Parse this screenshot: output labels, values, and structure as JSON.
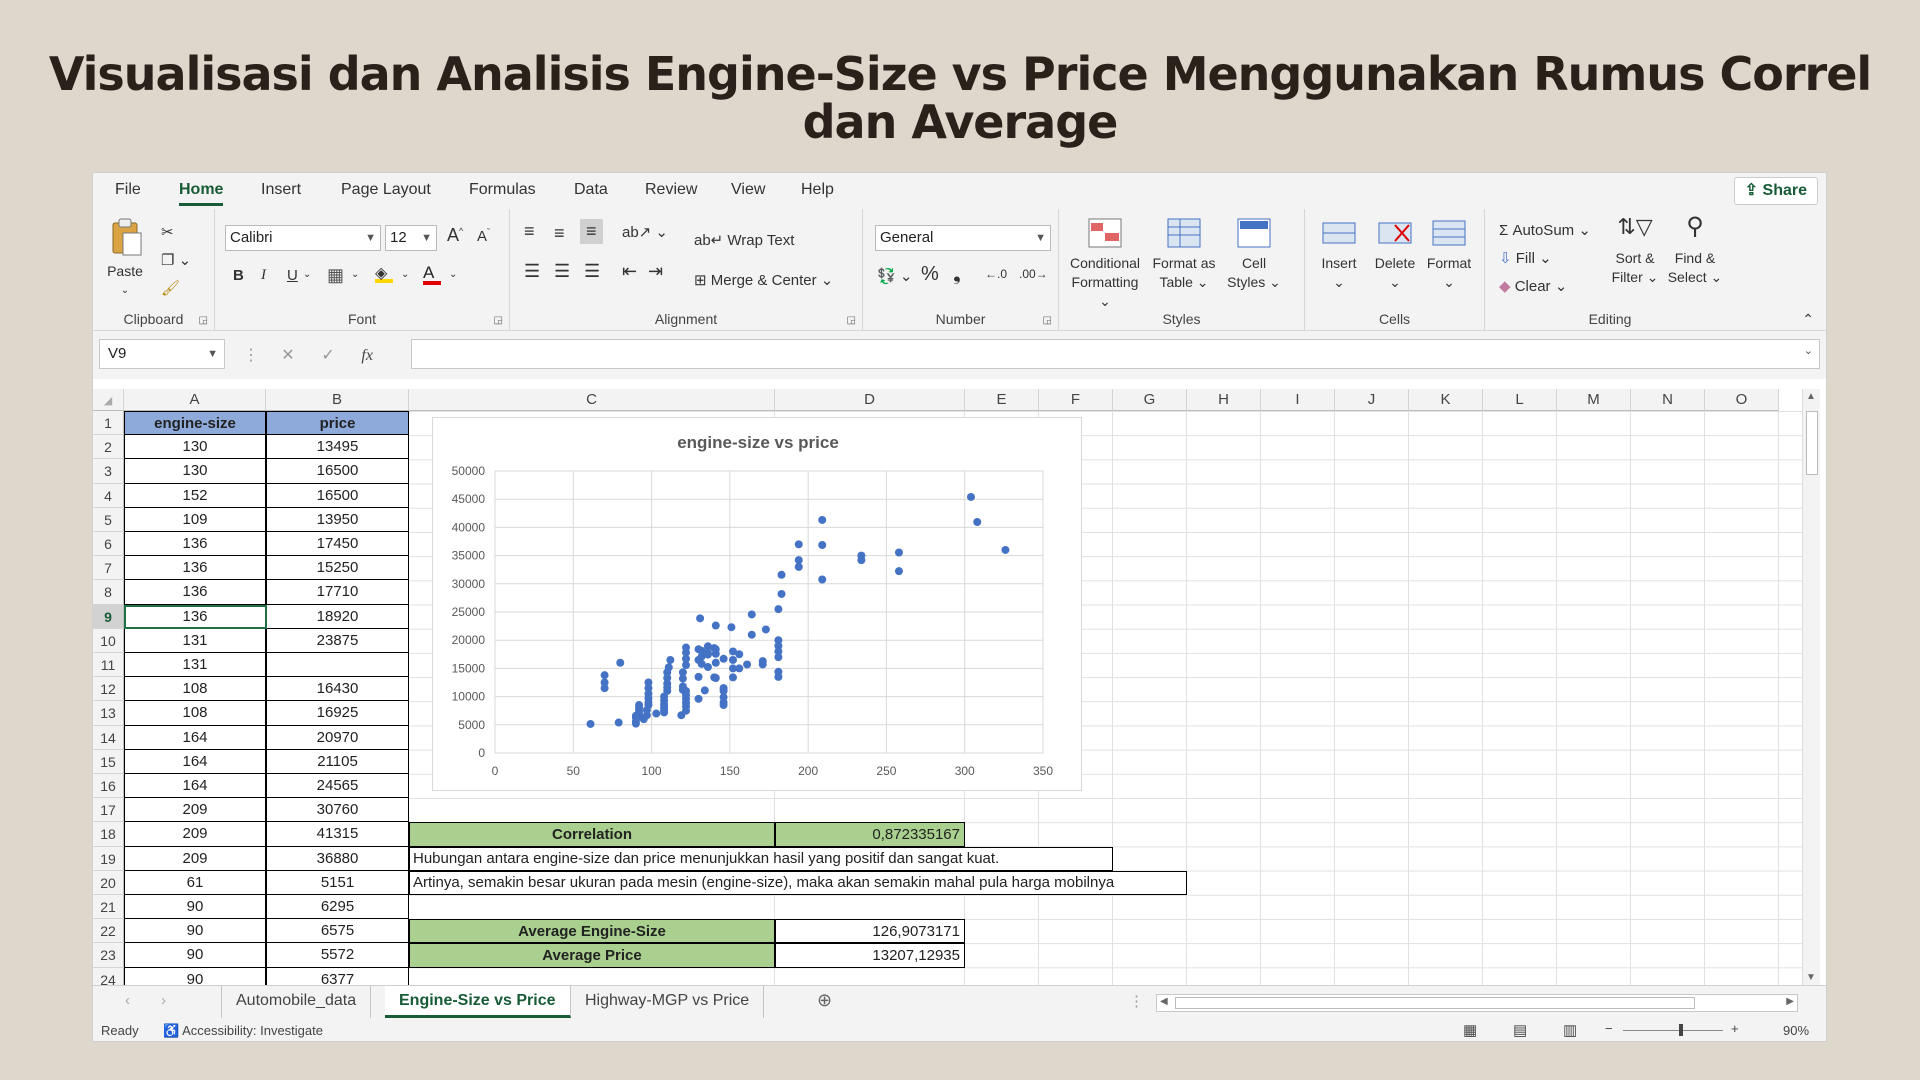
{
  "slide_title": "Visualisasi dan Analisis Engine-Size vs Price Menggunakan Rumus Correl dan Average",
  "menu": [
    "File",
    "Home",
    "Insert",
    "Page Layout",
    "Formulas",
    "Data",
    "Review",
    "View",
    "Help"
  ],
  "share_label": "Share",
  "ribbon": {
    "clipboard": {
      "paste": "Paste",
      "label": "Clipboard"
    },
    "font": {
      "family": "Calibri",
      "size": "12",
      "bold": "B",
      "italic": "I",
      "underline": "U",
      "label": "Font"
    },
    "alignment": {
      "wrap": "Wrap Text",
      "merge": "Merge & Center",
      "label": "Alignment"
    },
    "number": {
      "format": "General",
      "percent": "%",
      "comma": "❟",
      "label": "Number"
    },
    "styles": {
      "conditional_1": "Conditional",
      "conditional_2": "Formatting",
      "format_table_1": "Format as",
      "format_table_2": "Table",
      "cell_styles_1": "Cell",
      "cell_styles_2": "Styles",
      "label": "Styles"
    },
    "cells": {
      "insert": "Insert",
      "delete": "Delete",
      "format": "Format",
      "label": "Cells"
    },
    "editing": {
      "autosum": "AutoSum",
      "fill": "Fill",
      "clear": "Clear",
      "sort_1": "Sort &",
      "sort_2": "Filter",
      "find_1": "Find &",
      "find_2": "Select",
      "label": "Editing"
    }
  },
  "name_box": "V9",
  "fx_symbol": "fx",
  "columns": [
    "A",
    "B",
    "C",
    "D",
    "E",
    "F",
    "G",
    "H",
    "I",
    "J",
    "K",
    "L",
    "M",
    "N",
    "O"
  ],
  "table": {
    "headers": [
      "engine-size",
      "price"
    ],
    "rows": [
      [
        "130",
        "13495"
      ],
      [
        "130",
        "16500"
      ],
      [
        "152",
        "16500"
      ],
      [
        "109",
        "13950"
      ],
      [
        "136",
        "17450"
      ],
      [
        "136",
        "15250"
      ],
      [
        "136",
        "17710"
      ],
      [
        "136",
        "18920"
      ],
      [
        "131",
        "23875"
      ],
      [
        "131",
        ""
      ],
      [
        "108",
        "16430"
      ],
      [
        "108",
        "16925"
      ],
      [
        "164",
        "20970"
      ],
      [
        "164",
        "21105"
      ],
      [
        "164",
        "24565"
      ],
      [
        "209",
        "30760"
      ],
      [
        "209",
        "41315"
      ],
      [
        "209",
        "36880"
      ],
      [
        "61",
        "5151"
      ],
      [
        "90",
        "6295"
      ],
      [
        "90",
        "6575"
      ],
      [
        "90",
        "5572"
      ],
      [
        "90",
        "6377"
      ]
    ]
  },
  "analysis": {
    "correlation_label": "Correlation",
    "correlation_value": "0,872335167",
    "note_1": "Hubungan antara engine-size dan price menunjukkan hasil yang positif dan sangat kuat.",
    "note_2": "Artinya, semakin besar ukuran pada mesin (engine-size), maka akan semakin mahal pula harga mobilnya",
    "avg_engine_label": "Average Engine-Size",
    "avg_engine_value": "126,9073171",
    "avg_price_label": "Average Price",
    "avg_price_value": "13207,12935"
  },
  "sheet_tabs": [
    "Automobile_data",
    "Engine-Size vs Price",
    "Highway-MGP vs Price"
  ],
  "active_sheet": "Engine-Size vs Price",
  "status": {
    "ready": "Ready",
    "accessibility": "Accessibility: Investigate",
    "zoom": "90%"
  },
  "colors": {
    "header_blue": "#8eaadb",
    "green": "#a9d08e",
    "excel_green": "#185c37",
    "marker": "#4472c4"
  },
  "chart_data": {
    "type": "scatter",
    "title": "engine-size vs price",
    "xlim": [
      0,
      350
    ],
    "ylim": [
      0,
      50000
    ],
    "xticks": [
      "0",
      "50",
      "100",
      "150",
      "200",
      "250",
      "300",
      "350"
    ],
    "yticks": [
      "0",
      "5000",
      "10000",
      "15000",
      "20000",
      "25000",
      "30000",
      "35000",
      "40000",
      "45000",
      "50000"
    ],
    "grid": true,
    "series": [
      {
        "points": [
          [
            61,
            5151
          ],
          [
            70,
            11500
          ],
          [
            70,
            12500
          ],
          [
            70,
            13800
          ],
          [
            79,
            5400
          ],
          [
            80,
            16000
          ],
          [
            90,
            5200
          ],
          [
            90,
            5600
          ],
          [
            90,
            6300
          ],
          [
            90,
            6600
          ],
          [
            92,
            6500
          ],
          [
            92,
            7000
          ],
          [
            92,
            7500
          ],
          [
            92,
            8000
          ],
          [
            92,
            8500
          ],
          [
            95,
            6000
          ],
          [
            97,
            6700
          ],
          [
            97,
            7600
          ],
          [
            98,
            8500
          ],
          [
            98,
            9000
          ],
          [
            98,
            9700
          ],
          [
            98,
            10500
          ],
          [
            98,
            11500
          ],
          [
            98,
            12500
          ],
          [
            103,
            7000
          ],
          [
            108,
            7200
          ],
          [
            108,
            7600
          ],
          [
            108,
            8000
          ],
          [
            108,
            8600
          ],
          [
            108,
            9300
          ],
          [
            108,
            10000
          ],
          [
            110,
            11000
          ],
          [
            110,
            11600
          ],
          [
            110,
            12300
          ],
          [
            110,
            13300
          ],
          [
            110,
            14300
          ],
          [
            111,
            15200
          ],
          [
            112,
            16500
          ],
          [
            119,
            6700
          ],
          [
            120,
            11200
          ],
          [
            120,
            11800
          ],
          [
            120,
            13200
          ],
          [
            120,
            14300
          ],
          [
            122,
            7500
          ],
          [
            122,
            8300
          ],
          [
            122,
            8900
          ],
          [
            122,
            9600
          ],
          [
            122,
            10300
          ],
          [
            122,
            11000
          ],
          [
            122,
            15600
          ],
          [
            122,
            16700
          ],
          [
            122,
            17800
          ],
          [
            122,
            18700
          ],
          [
            130,
            9600
          ],
          [
            130,
            13500
          ],
          [
            130,
            16500
          ],
          [
            130,
            18400
          ],
          [
            131,
            23875
          ],
          [
            132,
            15800
          ],
          [
            132,
            17100
          ],
          [
            132,
            18100
          ],
          [
            134,
            11100
          ],
          [
            136,
            15250
          ],
          [
            136,
            17450
          ],
          [
            136,
            17710
          ],
          [
            136,
            18920
          ],
          [
            140,
            13400
          ],
          [
            140,
            18600
          ],
          [
            141,
            13300
          ],
          [
            141,
            16000
          ],
          [
            141,
            17600
          ],
          [
            141,
            18400
          ],
          [
            141,
            22600
          ],
          [
            146,
            8500
          ],
          [
            146,
            9000
          ],
          [
            146,
            9900
          ],
          [
            146,
            11000
          ],
          [
            146,
            11500
          ],
          [
            146,
            16700
          ],
          [
            151,
            22300
          ],
          [
            152,
            13400
          ],
          [
            152,
            15000
          ],
          [
            152,
            16500
          ],
          [
            152,
            18000
          ],
          [
            156,
            15000
          ],
          [
            156,
            17500
          ],
          [
            161,
            15700
          ],
          [
            164,
            20970
          ],
          [
            164,
            24565
          ],
          [
            171,
            15700
          ],
          [
            171,
            16300
          ],
          [
            173,
            21900
          ],
          [
            181,
            13500
          ],
          [
            181,
            14400
          ],
          [
            181,
            17000
          ],
          [
            181,
            18000
          ],
          [
            181,
            19000
          ],
          [
            181,
            20000
          ],
          [
            181,
            25500
          ],
          [
            183,
            28200
          ],
          [
            183,
            31600
          ],
          [
            194,
            33000
          ],
          [
            194,
            34200
          ],
          [
            194,
            37000
          ],
          [
            209,
            30760
          ],
          [
            209,
            36880
          ],
          [
            209,
            41315
          ],
          [
            234,
            34200
          ],
          [
            234,
            35000
          ],
          [
            258,
            32250
          ],
          [
            258,
            35550
          ],
          [
            304,
            45400
          ],
          [
            308,
            40960
          ],
          [
            326,
            36000
          ]
        ]
      }
    ]
  }
}
